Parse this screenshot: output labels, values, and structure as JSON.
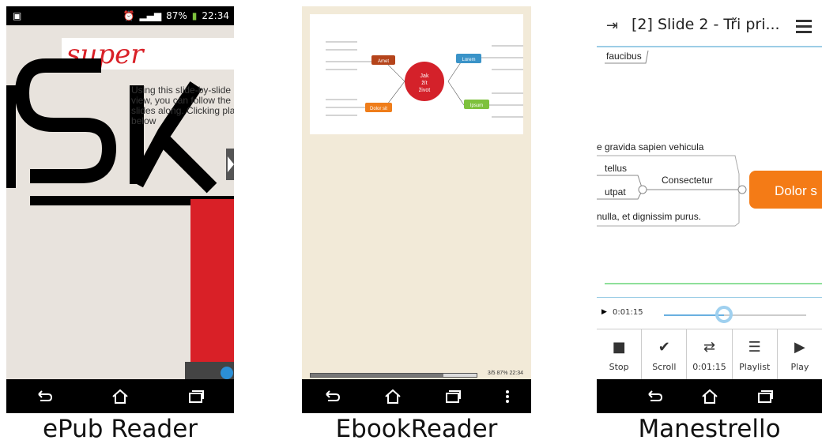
{
  "captions": [
    "ePub Reader",
    "EbookReader",
    "Manestrello"
  ],
  "epub": {
    "status_battery": "87%",
    "status_time": "22:34",
    "logo_text": "super",
    "overlay_text": "Using this slide-by-slide view, you can follow the slides along. Clicking play below"
  },
  "ebook": {
    "center_node": "Jak žít život",
    "nodes": [
      "Amet",
      "Lorem",
      "Dolor sit",
      "Ipsum"
    ],
    "status_text": "3/5 87% 22:34"
  },
  "manestrello": {
    "title": "[2] Slide 2 - Tři pri...",
    "map_lines": [
      "faucibus",
      "e gravida sapien vehicula",
      "tellus",
      "utpat",
      "Consectetur",
      "nulla, et dignissim purus.",
      "Dolor s"
    ],
    "elapsed": "0:01:15",
    "progress_fraction": 0.42,
    "buttons": [
      {
        "label": "Stop",
        "icon": "stop-icon"
      },
      {
        "label": "Scroll",
        "icon": "check-icon"
      },
      {
        "label": "0:01:15",
        "icon": "swap-icon"
      },
      {
        "label": "Playlist",
        "icon": "playlist-icon"
      },
      {
        "label": "Play",
        "icon": "play-icon"
      }
    ]
  }
}
